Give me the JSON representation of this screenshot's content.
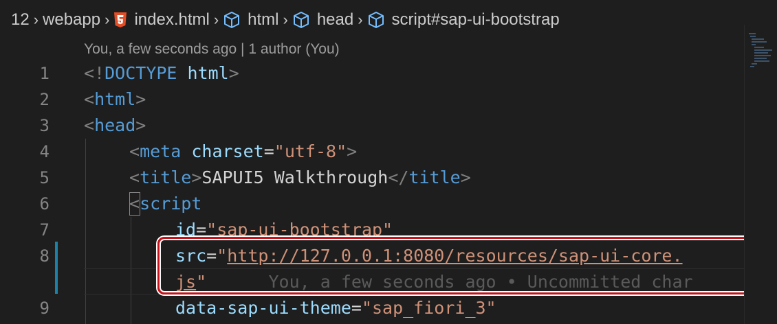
{
  "breadcrumb": {
    "items": [
      "12",
      "webapp",
      "index.html",
      "html",
      "head",
      "script#sap-ui-bootstrap"
    ]
  },
  "codelens": "You, a few seconds ago | 1 author (You)",
  "gutter": [
    "1",
    "2",
    "3",
    "4",
    "5",
    "6",
    "7",
    "8",
    "9"
  ],
  "code": {
    "l1": {
      "open": "<!",
      "tag": "DOCTYPE",
      "attr": "html",
      "close": ">"
    },
    "l2": {
      "open": "<",
      "tag": "html",
      "close": ">"
    },
    "l3": {
      "open": "<",
      "tag": "head",
      "close": ">"
    },
    "l4": {
      "open": "<",
      "tag": "meta",
      "attr": "charset",
      "eq": "=",
      "val": "\"utf-8\"",
      "close": ">"
    },
    "l5": {
      "open": "<",
      "tag": "title",
      "close": ">",
      "text": "SAPUI5 Walkthrough",
      "open2": "</",
      "tag2": "title",
      "close2": ">"
    },
    "l6": {
      "open": "<",
      "tag": "script"
    },
    "l7": {
      "attr": "id",
      "eq": "=",
      "val": "\"sap-ui-bootstrap\""
    },
    "l8": {
      "attr": "src",
      "eq": "=",
      "q": "\"",
      "url": "http://127.0.0.1:8080/resources/sap-ui-core."
    },
    "l8b": {
      "url": "js",
      "q": "\"",
      "blame": "You, a few seconds ago • Uncommitted char"
    },
    "l9": {
      "attr": "data-sap-ui-theme",
      "eq": "=",
      "val": "\"sap_fiori_3\""
    }
  },
  "colors": {
    "highlight": "#c6131b",
    "modified": "#1b81a8"
  },
  "icons": [
    "chevron-right-icon",
    "html5-icon",
    "cube-icon"
  ]
}
